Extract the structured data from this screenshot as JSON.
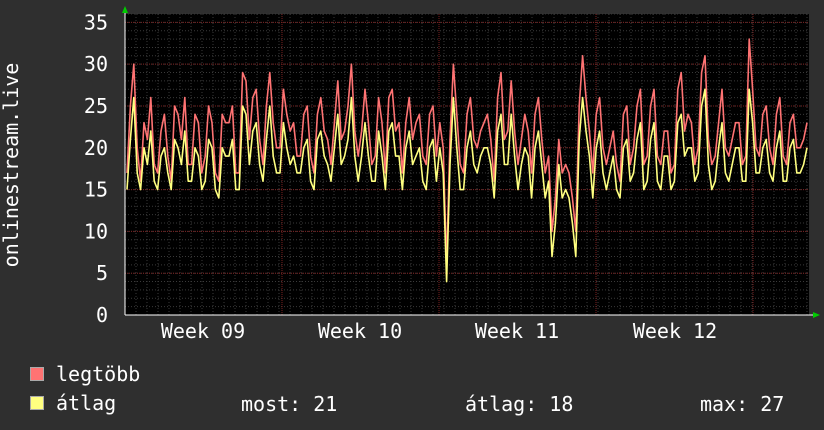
{
  "chart_data": {
    "type": "line",
    "ylabel": "onlinestream.live",
    "ylim": [
      0,
      36
    ],
    "yticks": [
      0,
      5,
      10,
      15,
      20,
      25,
      30,
      35
    ],
    "x_tick_labels": [
      "Week 09",
      "Week 10",
      "Week 11",
      "Week 12"
    ],
    "grid": true,
    "series": [
      {
        "name": "legtöbb",
        "color": "#ff7373",
        "values": [
          17,
          25,
          30,
          20,
          16,
          23,
          21,
          26,
          18,
          17,
          22,
          24,
          19,
          16,
          25,
          24,
          21,
          26,
          18,
          18,
          24,
          23,
          17,
          19,
          25,
          23,
          17,
          16,
          24,
          23,
          23,
          25,
          17,
          17,
          29,
          28,
          21,
          26,
          27,
          21,
          18,
          25,
          29,
          23,
          20,
          20,
          27,
          24,
          22,
          23,
          19,
          19,
          24,
          25,
          19,
          17,
          24,
          26,
          22,
          21,
          18,
          23,
          28,
          21,
          22,
          25,
          30,
          22,
          19,
          22,
          27,
          23,
          18,
          19,
          26,
          23,
          17,
          26,
          27,
          22,
          23,
          17,
          23,
          26,
          21,
          23,
          24,
          19,
          18,
          24,
          25,
          19,
          23,
          20,
          6,
          21,
          30,
          24,
          18,
          17,
          24,
          26,
          21,
          20,
          22,
          23,
          24,
          21,
          16,
          26,
          29,
          21,
          22,
          28,
          22,
          18,
          21,
          24,
          22,
          17,
          24,
          26,
          21,
          17,
          19,
          10,
          14,
          21,
          17,
          18,
          17,
          14,
          10,
          25,
          31,
          26,
          22,
          17,
          24,
          26,
          20,
          18,
          20,
          22,
          18,
          16,
          24,
          25,
          18,
          20,
          25,
          27,
          18,
          19,
          25,
          27,
          19,
          18,
          22,
          22,
          17,
          18,
          27,
          29,
          22,
          24,
          23,
          18,
          20,
          29,
          31,
          21,
          18,
          19,
          23,
          27,
          20,
          19,
          21,
          23,
          23,
          18,
          19,
          33,
          27,
          20,
          19,
          24,
          25,
          20,
          18,
          24,
          26,
          19,
          18,
          23,
          24,
          20,
          20,
          21,
          23
        ]
      },
      {
        "name": "átlag",
        "color": "#ffff80",
        "values": [
          15,
          21,
          26,
          17,
          15,
          20,
          18,
          22,
          16,
          15,
          19,
          20,
          17,
          15,
          21,
          20,
          18,
          22,
          16,
          16,
          20,
          19,
          15,
          16,
          21,
          20,
          15,
          14,
          20,
          19,
          19,
          21,
          15,
          15,
          25,
          24,
          18,
          22,
          23,
          18,
          16,
          21,
          25,
          19,
          17,
          17,
          23,
          20,
          18,
          19,
          17,
          17,
          20,
          21,
          16,
          15,
          21,
          22,
          19,
          18,
          16,
          20,
          24,
          18,
          19,
          21,
          26,
          19,
          16,
          19,
          23,
          19,
          16,
          16,
          22,
          19,
          15,
          22,
          23,
          19,
          19,
          15,
          20,
          22,
          18,
          19,
          20,
          16,
          15,
          20,
          21,
          16,
          20,
          17,
          4,
          18,
          26,
          20,
          15,
          15,
          20,
          22,
          18,
          17,
          19,
          20,
          20,
          18,
          14,
          22,
          24,
          18,
          18,
          24,
          19,
          15,
          18,
          20,
          19,
          14,
          20,
          22,
          18,
          14,
          16,
          7,
          11,
          18,
          14,
          15,
          14,
          11,
          7,
          21,
          26,
          22,
          19,
          14,
          20,
          22,
          17,
          15,
          17,
          19,
          15,
          14,
          20,
          21,
          16,
          17,
          21,
          23,
          15,
          16,
          21,
          23,
          16,
          15,
          19,
          19,
          15,
          16,
          23,
          24,
          19,
          20,
          20,
          16,
          17,
          25,
          27,
          18,
          15,
          16,
          20,
          23,
          17,
          16,
          18,
          20,
          20,
          16,
          16,
          27,
          23,
          17,
          17,
          20,
          21,
          17,
          16,
          20,
          22,
          16,
          16,
          20,
          21,
          17,
          17,
          18,
          20
        ]
      }
    ]
  },
  "legend": {
    "items": [
      {
        "label": "legtöbb",
        "color": "#ff7373"
      },
      {
        "label": "átlag",
        "color": "#ffff80"
      }
    ],
    "stats": {
      "now": "most: 21",
      "avg": "átlag: 18",
      "max": "max: 27"
    }
  }
}
